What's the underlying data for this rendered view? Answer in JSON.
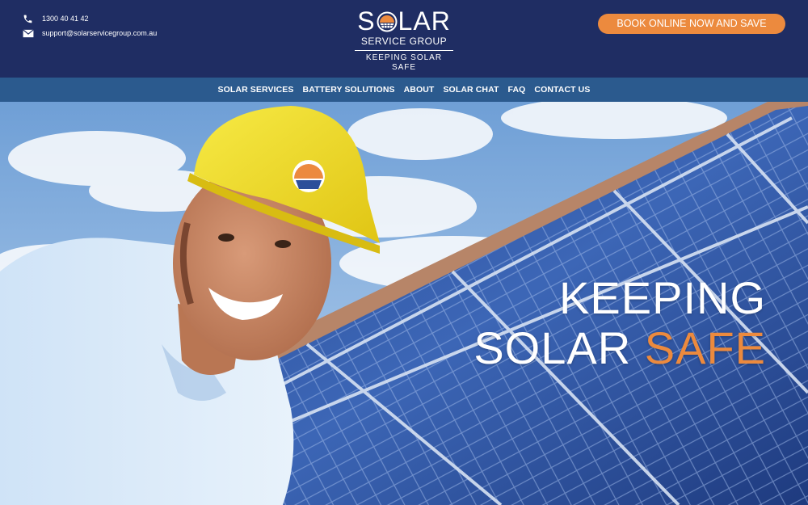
{
  "header": {
    "phone": "1300 40 41 42",
    "email": "support@solarservicegroup.com.au",
    "phone_icon": "phone-icon",
    "email_icon": "envelope-icon",
    "book_button": "BOOK ONLINE NOW AND SAVE"
  },
  "logo": {
    "word_start": "S",
    "word_end": "LAR",
    "sub": "SERVICE GROUP",
    "tagline": "KEEPING SOLAR SAFE"
  },
  "nav": {
    "items": [
      "SOLAR SERVICES",
      "BATTERY SOLUTIONS",
      "ABOUT",
      "SOLAR CHAT",
      "FAQ",
      "CONTACT US"
    ]
  },
  "hero": {
    "line1": "KEEPING",
    "line2_a": "SOLAR ",
    "line2_b": "SAFE"
  },
  "colors": {
    "header_bg": "#1f2d63",
    "nav_bg": "#2b5a8e",
    "accent": "#ec8a3e"
  }
}
